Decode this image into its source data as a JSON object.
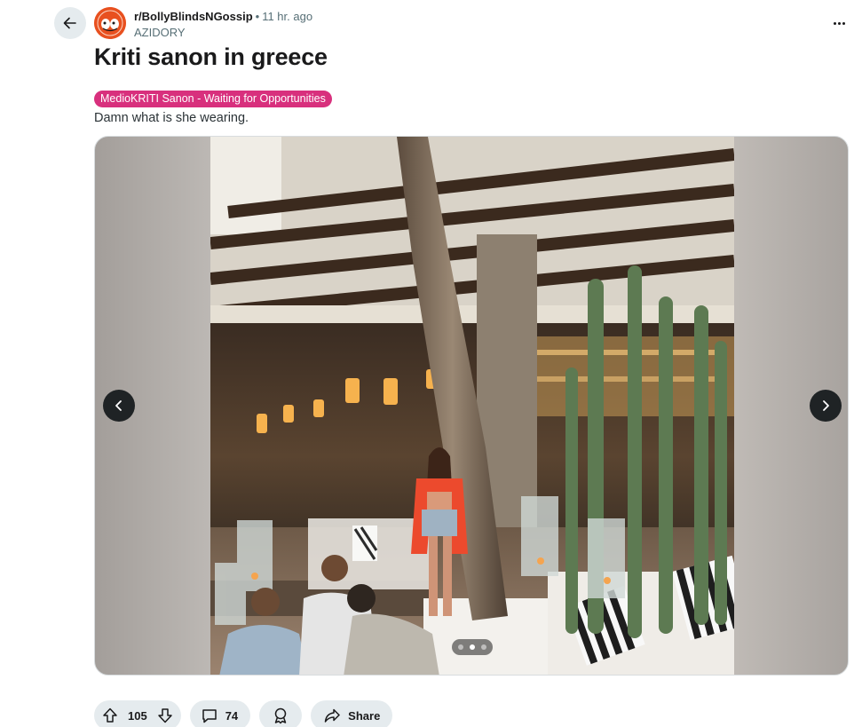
{
  "post": {
    "subreddit": "r/BollyBlindsNGossip",
    "separator": "•",
    "time": "11 hr. ago",
    "author": "AZIDORY",
    "title": "Kriti sanon in greece",
    "flair": "MedioKRITI Sanon - Waiting for Opportunities",
    "body": "Damn what is she wearing."
  },
  "media": {
    "slide_count": 3,
    "current_slide": 2
  },
  "actions": {
    "upvotes": "105",
    "comments": "74",
    "share_label": "Share"
  },
  "colors": {
    "flair_bg": "#d8307d",
    "pill_bg": "#e5ebee",
    "avatar_bg": "#e8501f"
  },
  "icons": {
    "back": "arrow-left-icon",
    "overflow": "more-horizontal-icon",
    "upvote": "arrow-up-icon",
    "downvote": "arrow-down-icon",
    "comment": "speech-bubble-icon",
    "award": "award-icon",
    "share": "share-arrow-icon",
    "prev": "chevron-left-icon",
    "next": "chevron-right-icon"
  }
}
